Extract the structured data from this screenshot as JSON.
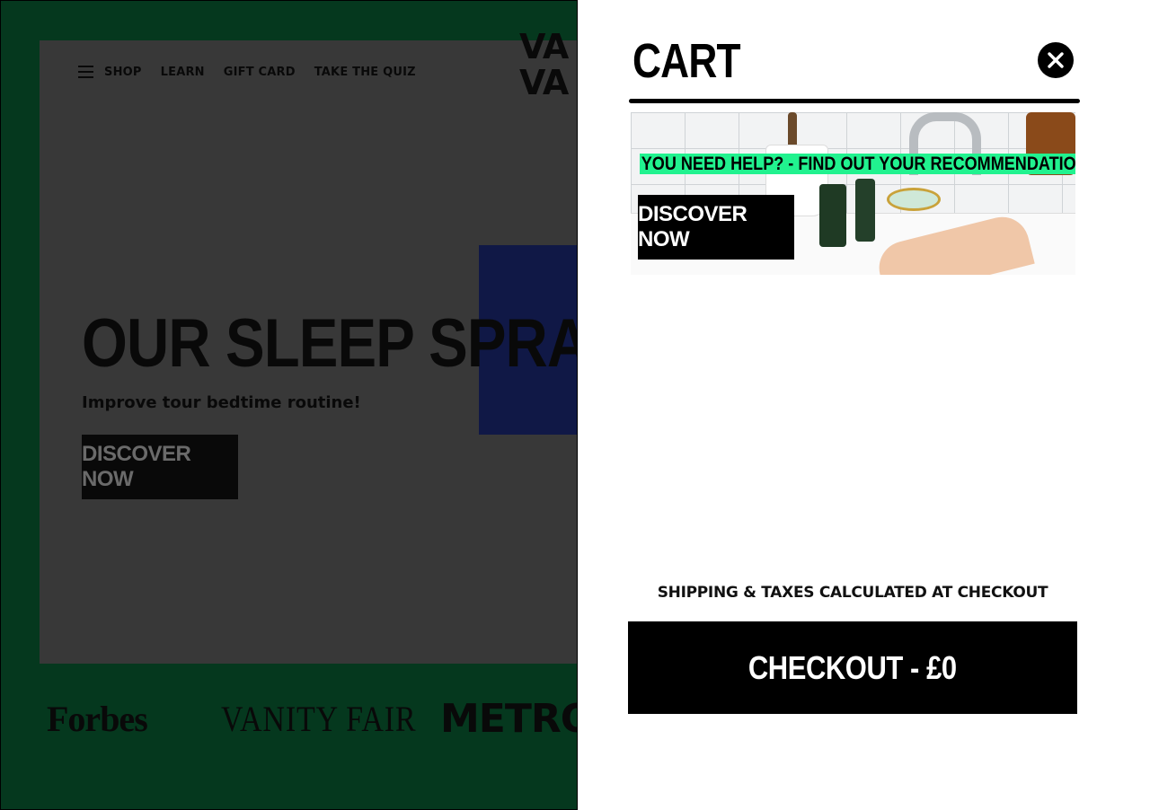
{
  "background_page": {
    "nav": {
      "items": [
        "SHOP",
        "LEARN",
        "GIFT CARD",
        "TAKE THE QUIZ"
      ]
    },
    "logo_text": "VA\nVA",
    "hero": {
      "title": "OUR SLEEP SPRAY!",
      "subtitle": "Improve tour bedtime routine!",
      "button_label": "DISCOVER NOW"
    },
    "press_logos": [
      "Forbes",
      "VANITY FAIR",
      "METRO"
    ]
  },
  "cart": {
    "title": "CART",
    "close_icon": "close-icon",
    "promo": {
      "headline": "YOU NEED HELP? - FIND OUT YOUR RECOMMENDATION",
      "button_label": "DISCOVER NOW"
    },
    "shipping_note": "SHIPPING & TAXES CALCULATED AT CHECKOUT",
    "checkout_label": "CHECKOUT - £0"
  },
  "colors": {
    "page_green": "#0b6a3a",
    "highlight_green": "#21f28f",
    "hero_blue": "#1f2e84",
    "black": "#000000",
    "white": "#ffffff"
  }
}
